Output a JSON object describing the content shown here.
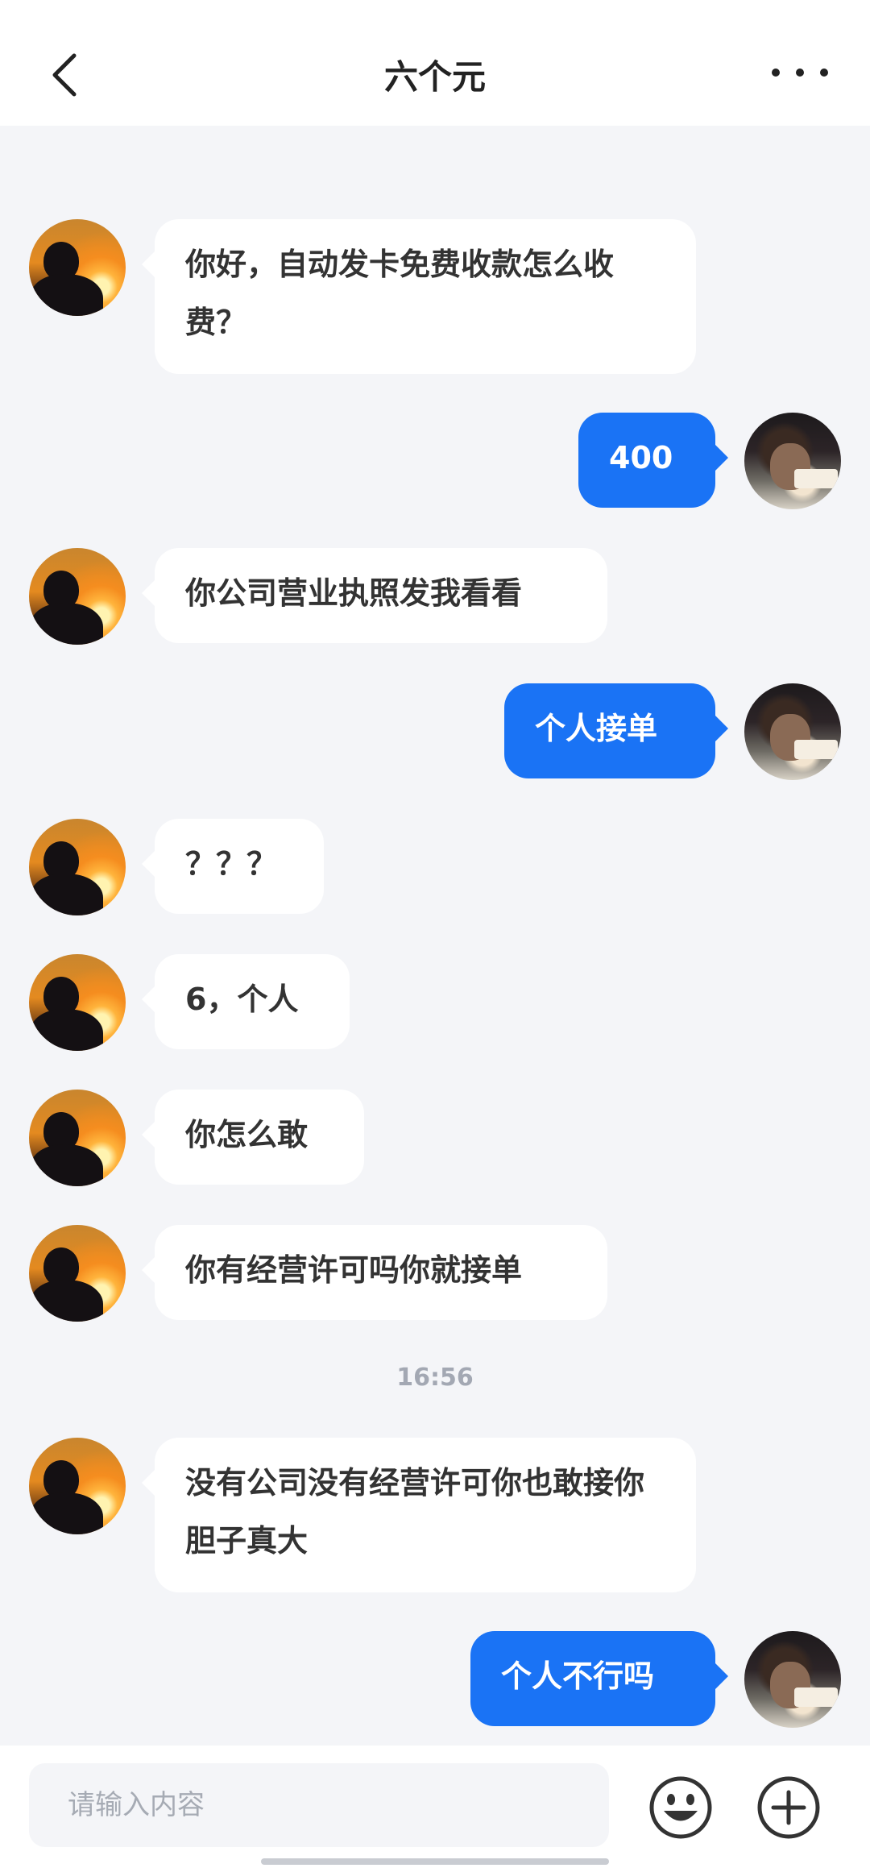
{
  "header": {
    "title": "六个元",
    "back_icon": "chevron-left-icon",
    "more_icon": "more-dots-icon"
  },
  "messages": [
    {
      "side": "left",
      "text": "你好，自动发卡免费收款怎么收费？"
    },
    {
      "side": "right",
      "text": "400"
    },
    {
      "side": "left",
      "text": "你公司营业执照发我看看"
    },
    {
      "side": "right",
      "text": "个人接单"
    },
    {
      "side": "left",
      "text": "？？？"
    },
    {
      "side": "left",
      "text": "6，个人"
    },
    {
      "side": "left",
      "text": "你怎么敢"
    },
    {
      "side": "left",
      "text": "你有经营许可吗你就接单"
    },
    {
      "side": "left",
      "text": "没有公司没有经营许可你也敢接你胆子真大"
    },
    {
      "side": "right",
      "text": "个人不行吗"
    }
  ],
  "timestamp": "16:56",
  "composer": {
    "placeholder": "请输入内容",
    "emoji_icon": "emoji-icon",
    "plus_icon": "plus-icon"
  },
  "colors": {
    "accent": "#1a73f5",
    "background": "#f4f5f8",
    "bubble_left": "#ffffff"
  }
}
